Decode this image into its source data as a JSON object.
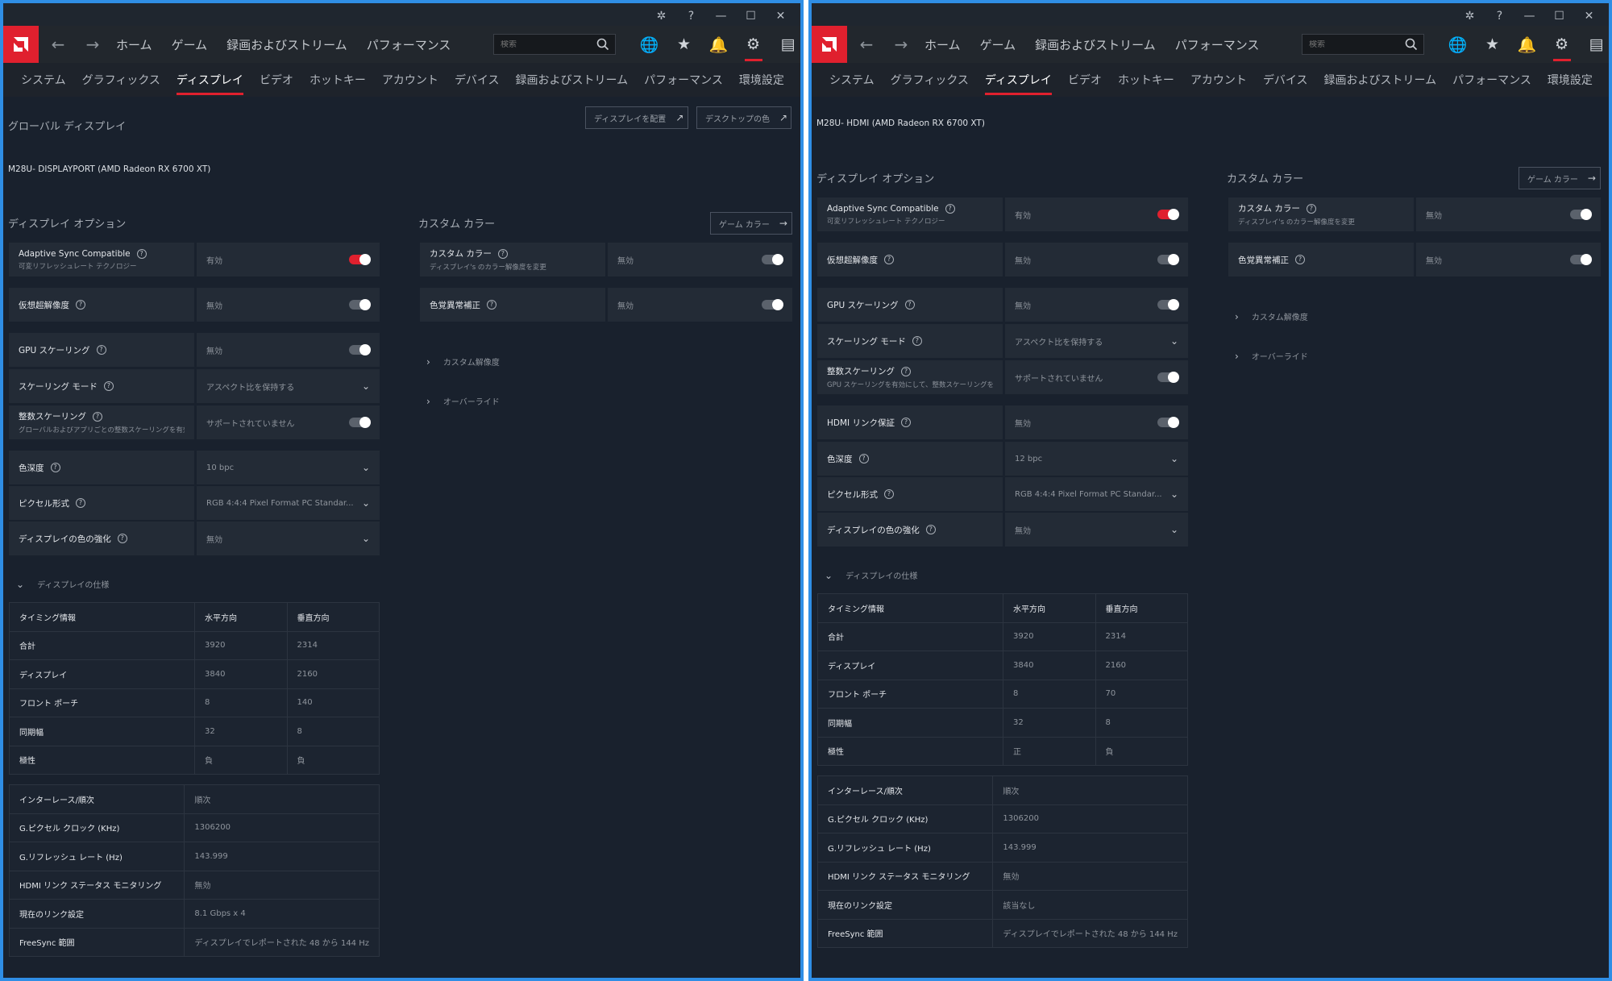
{
  "left": {
    "subtitle": "グローバル ディスプレイ",
    "monitor": "M28U- DISPLAYPORT (AMD Radeon RX 6700 XT)",
    "arrange_button": "ディスプレイを配置",
    "desktop_color_button": "デスクトップの色",
    "options": [
      {
        "label": "Adaptive Sync Compatible",
        "sub": "可変リフレッシュレート テクノロジー",
        "value": "有効",
        "control": "toggle-on"
      },
      {
        "label": "仮想超解像度",
        "sub": "",
        "value": "無効",
        "control": "toggle-off"
      },
      {
        "label": "GPU スケーリング",
        "sub": "",
        "value": "無効",
        "control": "toggle-off"
      },
      {
        "label": "スケーリング モード",
        "sub": "",
        "value": "アスペクト比を保持する",
        "control": "dropdown"
      },
      {
        "label": "整数スケーリング",
        "sub": "グローバルおよびアプリごとの整数スケーリングを有効に...",
        "value": "サポートされていません",
        "control": "toggle-off"
      },
      {
        "label": "色深度",
        "sub": "",
        "value": "10 bpc",
        "control": "dropdown"
      },
      {
        "label": "ピクセル形式",
        "sub": "",
        "value": "RGB 4:4:4 Pixel Format PC Standar...",
        "control": "dropdown"
      },
      {
        "label": "ディスプレイの色の強化",
        "sub": "",
        "value": "無効",
        "control": "dropdown"
      }
    ],
    "custom": [
      {
        "label": "カスタム カラー",
        "sub": "ディスプレイ's のカラー解像度を変更",
        "value": "無効",
        "control": "toggle-off"
      },
      {
        "label": "色覚異常補正",
        "sub": "",
        "value": "無効",
        "control": "toggle-off"
      }
    ],
    "timing": [
      [
        "合計",
        "3920",
        "2314"
      ],
      [
        "ディスプレイ",
        "3840",
        "2160"
      ],
      [
        "フロント ポーチ",
        "8",
        "140"
      ],
      [
        "同期幅",
        "32",
        "8"
      ],
      [
        "極性",
        "負",
        "負"
      ]
    ],
    "extra": [
      [
        "インターレース/順次",
        "順次"
      ],
      [
        "G.ピクセル クロック (KHz)",
        "1306200"
      ],
      [
        "G.リフレッシュ レート (Hz)",
        "143.999"
      ],
      [
        "HDMI リンク ステータス モニタリング",
        "無効"
      ],
      [
        "現在のリンク設定",
        "8.1 Gbps x 4"
      ],
      [
        "FreeSync 範囲",
        "ディスプレイでレポートされた 48 から 144 Hz"
      ]
    ]
  },
  "right": {
    "monitor": "M28U- HDMI (AMD Radeon RX 6700 XT)",
    "options": [
      {
        "label": "Adaptive Sync Compatible",
        "sub": "可変リフレッシュレート テクノロジー",
        "value": "有効",
        "control": "toggle-on"
      },
      {
        "label": "仮想超解像度",
        "sub": "",
        "value": "無効",
        "control": "toggle-off"
      },
      {
        "label": "GPU スケーリング",
        "sub": "",
        "value": "無効",
        "control": "toggle-off"
      },
      {
        "label": "スケーリング モード",
        "sub": "",
        "value": "アスペクト比を保持する",
        "control": "dropdown"
      },
      {
        "label": "整数スケーリング",
        "sub": "GPU スケーリングを有効にして、整数スケーリングを可...",
        "value": "サポートされていません",
        "control": "toggle-off"
      },
      {
        "label": "HDMI リンク保証",
        "sub": "",
        "value": "無効",
        "control": "toggle-off"
      },
      {
        "label": "色深度",
        "sub": "",
        "value": "12 bpc",
        "control": "dropdown"
      },
      {
        "label": "ピクセル形式",
        "sub": "",
        "value": "RGB 4:4:4 Pixel Format PC Standar...",
        "control": "dropdown"
      },
      {
        "label": "ディスプレイの色の強化",
        "sub": "",
        "value": "無効",
        "control": "dropdown"
      }
    ],
    "custom": [
      {
        "label": "カスタム カラー",
        "sub": "ディスプレイ's のカラー解像度を変更",
        "value": "無効",
        "control": "toggle-off"
      },
      {
        "label": "色覚異常補正",
        "sub": "",
        "value": "無効",
        "control": "toggle-off"
      }
    ],
    "timing": [
      [
        "合計",
        "3920",
        "2314"
      ],
      [
        "ディスプレイ",
        "3840",
        "2160"
      ],
      [
        "フロント ポーチ",
        "8",
        "70"
      ],
      [
        "同期幅",
        "32",
        "8"
      ],
      [
        "極性",
        "正",
        "負"
      ]
    ],
    "extra": [
      [
        "インターレース/順次",
        "順次"
      ],
      [
        "G.ピクセル クロック (KHz)",
        "1306200"
      ],
      [
        "G.リフレッシュ レート (Hz)",
        "143.999"
      ],
      [
        "HDMI リンク ステータス モニタリング",
        "無効"
      ],
      [
        "現在のリンク設定",
        "該当なし"
      ],
      [
        "FreeSync 範囲",
        "ディスプレイでレポートされた 48 から 144 Hz"
      ]
    ]
  },
  "common": {
    "nav": [
      "ホーム",
      "ゲーム",
      "録画およびストリーム",
      "パフォーマンス"
    ],
    "search_placeholder": "検索",
    "subtabs": [
      "システム",
      "グラフィックス",
      "ディスプレイ",
      "ビデオ",
      "ホットキー",
      "アカウント",
      "デバイス",
      "録画およびストリーム",
      "パフォーマンス",
      "環境設定"
    ],
    "display_options": "ディスプレイ オプション",
    "custom_color": "カスタム カラー",
    "game_color_button": "ゲーム カラー",
    "custom_resolution": "カスタム解像度",
    "override": "オーバーライド",
    "display_spec": "ディスプレイの仕様",
    "timing_header": [
      "タイミング情報",
      "水平方向",
      "垂直方向"
    ]
  },
  "colors": {
    "accent": "#e0202e",
    "window_border": "#2f8ee5"
  }
}
